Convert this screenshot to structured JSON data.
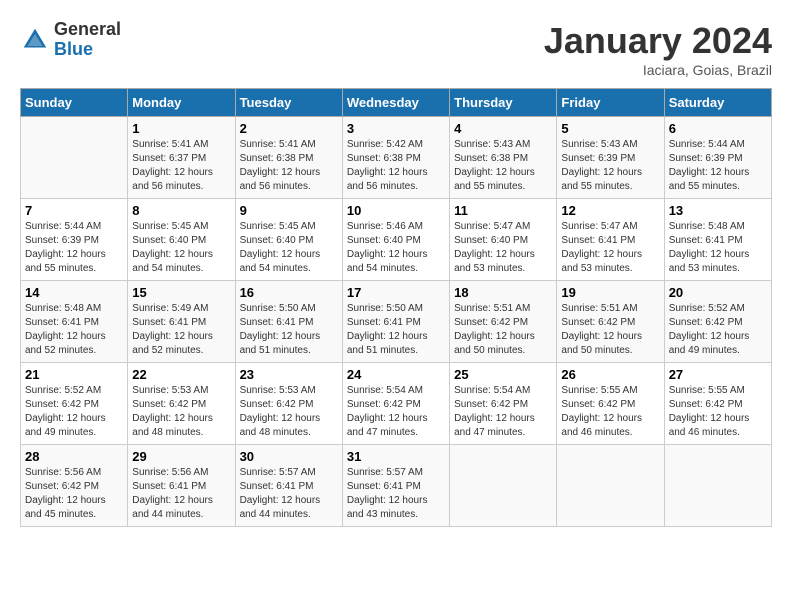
{
  "header": {
    "logo_general": "General",
    "logo_blue": "Blue",
    "month_title": "January 2024",
    "subtitle": "Iaciara, Goias, Brazil"
  },
  "days_of_week": [
    "Sunday",
    "Monday",
    "Tuesday",
    "Wednesday",
    "Thursday",
    "Friday",
    "Saturday"
  ],
  "weeks": [
    [
      {
        "num": "",
        "info": ""
      },
      {
        "num": "1",
        "info": "Sunrise: 5:41 AM\nSunset: 6:37 PM\nDaylight: 12 hours\nand 56 minutes."
      },
      {
        "num": "2",
        "info": "Sunrise: 5:41 AM\nSunset: 6:38 PM\nDaylight: 12 hours\nand 56 minutes."
      },
      {
        "num": "3",
        "info": "Sunrise: 5:42 AM\nSunset: 6:38 PM\nDaylight: 12 hours\nand 56 minutes."
      },
      {
        "num": "4",
        "info": "Sunrise: 5:43 AM\nSunset: 6:38 PM\nDaylight: 12 hours\nand 55 minutes."
      },
      {
        "num": "5",
        "info": "Sunrise: 5:43 AM\nSunset: 6:39 PM\nDaylight: 12 hours\nand 55 minutes."
      },
      {
        "num": "6",
        "info": "Sunrise: 5:44 AM\nSunset: 6:39 PM\nDaylight: 12 hours\nand 55 minutes."
      }
    ],
    [
      {
        "num": "7",
        "info": "Sunrise: 5:44 AM\nSunset: 6:39 PM\nDaylight: 12 hours\nand 55 minutes."
      },
      {
        "num": "8",
        "info": "Sunrise: 5:45 AM\nSunset: 6:40 PM\nDaylight: 12 hours\nand 54 minutes."
      },
      {
        "num": "9",
        "info": "Sunrise: 5:45 AM\nSunset: 6:40 PM\nDaylight: 12 hours\nand 54 minutes."
      },
      {
        "num": "10",
        "info": "Sunrise: 5:46 AM\nSunset: 6:40 PM\nDaylight: 12 hours\nand 54 minutes."
      },
      {
        "num": "11",
        "info": "Sunrise: 5:47 AM\nSunset: 6:40 PM\nDaylight: 12 hours\nand 53 minutes."
      },
      {
        "num": "12",
        "info": "Sunrise: 5:47 AM\nSunset: 6:41 PM\nDaylight: 12 hours\nand 53 minutes."
      },
      {
        "num": "13",
        "info": "Sunrise: 5:48 AM\nSunset: 6:41 PM\nDaylight: 12 hours\nand 53 minutes."
      }
    ],
    [
      {
        "num": "14",
        "info": "Sunrise: 5:48 AM\nSunset: 6:41 PM\nDaylight: 12 hours\nand 52 minutes."
      },
      {
        "num": "15",
        "info": "Sunrise: 5:49 AM\nSunset: 6:41 PM\nDaylight: 12 hours\nand 52 minutes."
      },
      {
        "num": "16",
        "info": "Sunrise: 5:50 AM\nSunset: 6:41 PM\nDaylight: 12 hours\nand 51 minutes."
      },
      {
        "num": "17",
        "info": "Sunrise: 5:50 AM\nSunset: 6:41 PM\nDaylight: 12 hours\nand 51 minutes."
      },
      {
        "num": "18",
        "info": "Sunrise: 5:51 AM\nSunset: 6:42 PM\nDaylight: 12 hours\nand 50 minutes."
      },
      {
        "num": "19",
        "info": "Sunrise: 5:51 AM\nSunset: 6:42 PM\nDaylight: 12 hours\nand 50 minutes."
      },
      {
        "num": "20",
        "info": "Sunrise: 5:52 AM\nSunset: 6:42 PM\nDaylight: 12 hours\nand 49 minutes."
      }
    ],
    [
      {
        "num": "21",
        "info": "Sunrise: 5:52 AM\nSunset: 6:42 PM\nDaylight: 12 hours\nand 49 minutes."
      },
      {
        "num": "22",
        "info": "Sunrise: 5:53 AM\nSunset: 6:42 PM\nDaylight: 12 hours\nand 48 minutes."
      },
      {
        "num": "23",
        "info": "Sunrise: 5:53 AM\nSunset: 6:42 PM\nDaylight: 12 hours\nand 48 minutes."
      },
      {
        "num": "24",
        "info": "Sunrise: 5:54 AM\nSunset: 6:42 PM\nDaylight: 12 hours\nand 47 minutes."
      },
      {
        "num": "25",
        "info": "Sunrise: 5:54 AM\nSunset: 6:42 PM\nDaylight: 12 hours\nand 47 minutes."
      },
      {
        "num": "26",
        "info": "Sunrise: 5:55 AM\nSunset: 6:42 PM\nDaylight: 12 hours\nand 46 minutes."
      },
      {
        "num": "27",
        "info": "Sunrise: 5:55 AM\nSunset: 6:42 PM\nDaylight: 12 hours\nand 46 minutes."
      }
    ],
    [
      {
        "num": "28",
        "info": "Sunrise: 5:56 AM\nSunset: 6:42 PM\nDaylight: 12 hours\nand 45 minutes."
      },
      {
        "num": "29",
        "info": "Sunrise: 5:56 AM\nSunset: 6:41 PM\nDaylight: 12 hours\nand 44 minutes."
      },
      {
        "num": "30",
        "info": "Sunrise: 5:57 AM\nSunset: 6:41 PM\nDaylight: 12 hours\nand 44 minutes."
      },
      {
        "num": "31",
        "info": "Sunrise: 5:57 AM\nSunset: 6:41 PM\nDaylight: 12 hours\nand 43 minutes."
      },
      {
        "num": "",
        "info": ""
      },
      {
        "num": "",
        "info": ""
      },
      {
        "num": "",
        "info": ""
      }
    ]
  ]
}
